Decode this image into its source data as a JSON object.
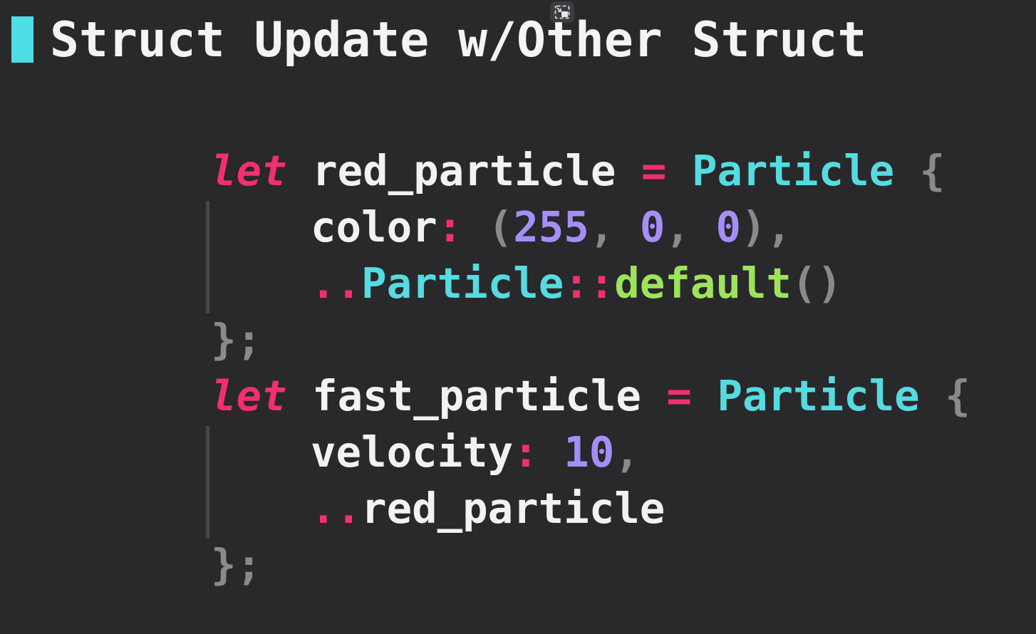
{
  "toolbar": {
    "pip_icon": "picture-in-picture-exit-icon"
  },
  "slide": {
    "title": "Struct Update w/Other Struct",
    "accent_color": "#4fdde7"
  },
  "code": {
    "line1": {
      "keyword": "let",
      "var": "red_particle",
      "op": "=",
      "type": "Particle",
      "brace": "{"
    },
    "line2": {
      "field": "color",
      "colon": ":",
      "open": "(",
      "n1": "255",
      "c1": ",",
      "n2": "0",
      "c2": ",",
      "n3": "0",
      "close": ")",
      "c3": ","
    },
    "line3": {
      "dots": "..",
      "type": "Particle",
      "sep": "::",
      "fn": "default",
      "parens": "()"
    },
    "line4": {
      "close": "};"
    },
    "line5": {
      "keyword": "let",
      "var": "fast_particle",
      "op": "=",
      "type": "Particle",
      "brace": "{"
    },
    "line6": {
      "field": "velocity",
      "colon": ":",
      "num": "10",
      "comma": ","
    },
    "line7": {
      "dots": "..",
      "var": "red_particle"
    },
    "line8": {
      "close": "};"
    }
  }
}
